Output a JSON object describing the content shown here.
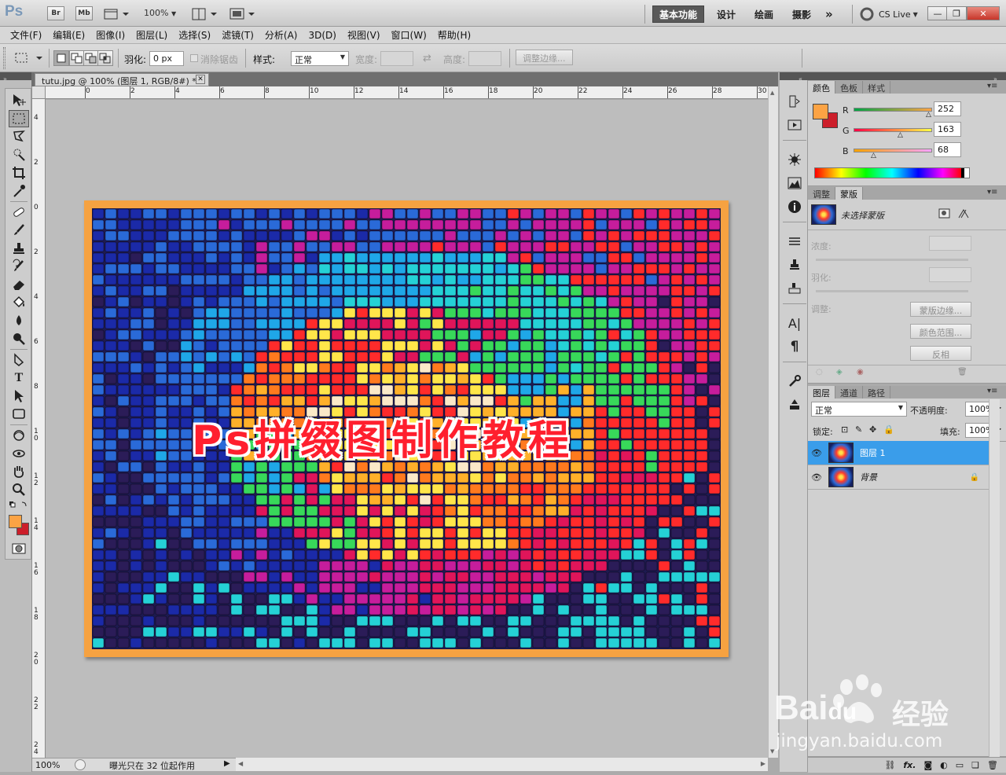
{
  "app": {
    "logo": "Ps",
    "bridge": "Br",
    "minibridge": "Mb",
    "zoom_label": "100%",
    "workspaces": [
      "基本功能",
      "设计",
      "绘画",
      "摄影"
    ],
    "more": "»",
    "cslive": "CS Live"
  },
  "window_controls": {
    "minimize": "—",
    "restore": "❐",
    "close": "✕"
  },
  "menu": [
    "文件(F)",
    "编辑(E)",
    "图像(I)",
    "图层(L)",
    "选择(S)",
    "滤镜(T)",
    "分析(A)",
    "3D(D)",
    "视图(V)",
    "窗口(W)",
    "帮助(H)"
  ],
  "options": {
    "feather_label": "羽化:",
    "feather_value": "0 px",
    "antialias_label": "消除锯齿",
    "style_label": "样式:",
    "style_value": "正常",
    "width_label": "宽度:",
    "height_label": "高度:",
    "refine_button": "调整边缘..."
  },
  "document": {
    "tab_title": "tutu.jpg @ 100% (图层 1, RGB/8#) *",
    "close": "✕",
    "overlay_text": "Ps拼缀图制作教程",
    "zoom": "100%",
    "status": "曝光只在 32 位起作用"
  },
  "ruler": {
    "top": [
      "0",
      "2",
      "4",
      "6",
      "8",
      "10",
      "12",
      "14",
      "16",
      "18",
      "20",
      "22",
      "24",
      "26",
      "28",
      "30"
    ],
    "left": [
      "4",
      "2",
      "0",
      "2",
      "4",
      "6",
      "8",
      "1 0",
      "1 2",
      "1 4",
      "1 6",
      "1 8",
      "2 0",
      "2 2",
      "2 4"
    ]
  },
  "color_panel": {
    "tabs": [
      "颜色",
      "色板",
      "样式"
    ],
    "r_label": "R",
    "g_label": "G",
    "b_label": "B",
    "r": 252,
    "g": 163,
    "b": 68,
    "foreground": "#fca344",
    "background": "#cc1e2a"
  },
  "masks_panel": {
    "tabs": [
      "调整",
      "蒙版"
    ],
    "no_selection": "未选择蒙版",
    "density_label": "浓度:",
    "feather_label": "羽化:",
    "refine_label": "调整:",
    "mask_edge_button": "蒙版边缘...",
    "color_range_button": "颜色范围...",
    "invert_button": "反相"
  },
  "layers_panel": {
    "tabs": [
      "图层",
      "通道",
      "路径"
    ],
    "blend_mode": "正常",
    "opacity_label": "不透明度:",
    "opacity_value": "100%",
    "lock_label": "锁定:",
    "fill_label": "填充:",
    "fill_value": "100%",
    "layers": [
      {
        "name": "图层 1",
        "selected": true
      },
      {
        "name": "背景",
        "selected": false,
        "locked": true
      }
    ]
  },
  "watermark": {
    "brand": "Bai",
    "brand2": "du",
    "cn": "经验",
    "url": "jingyan.baidu.com"
  },
  "colors": {
    "accent": "#3a9dea",
    "frame": "#f6a241",
    "title_red": "#ff1f2e"
  }
}
